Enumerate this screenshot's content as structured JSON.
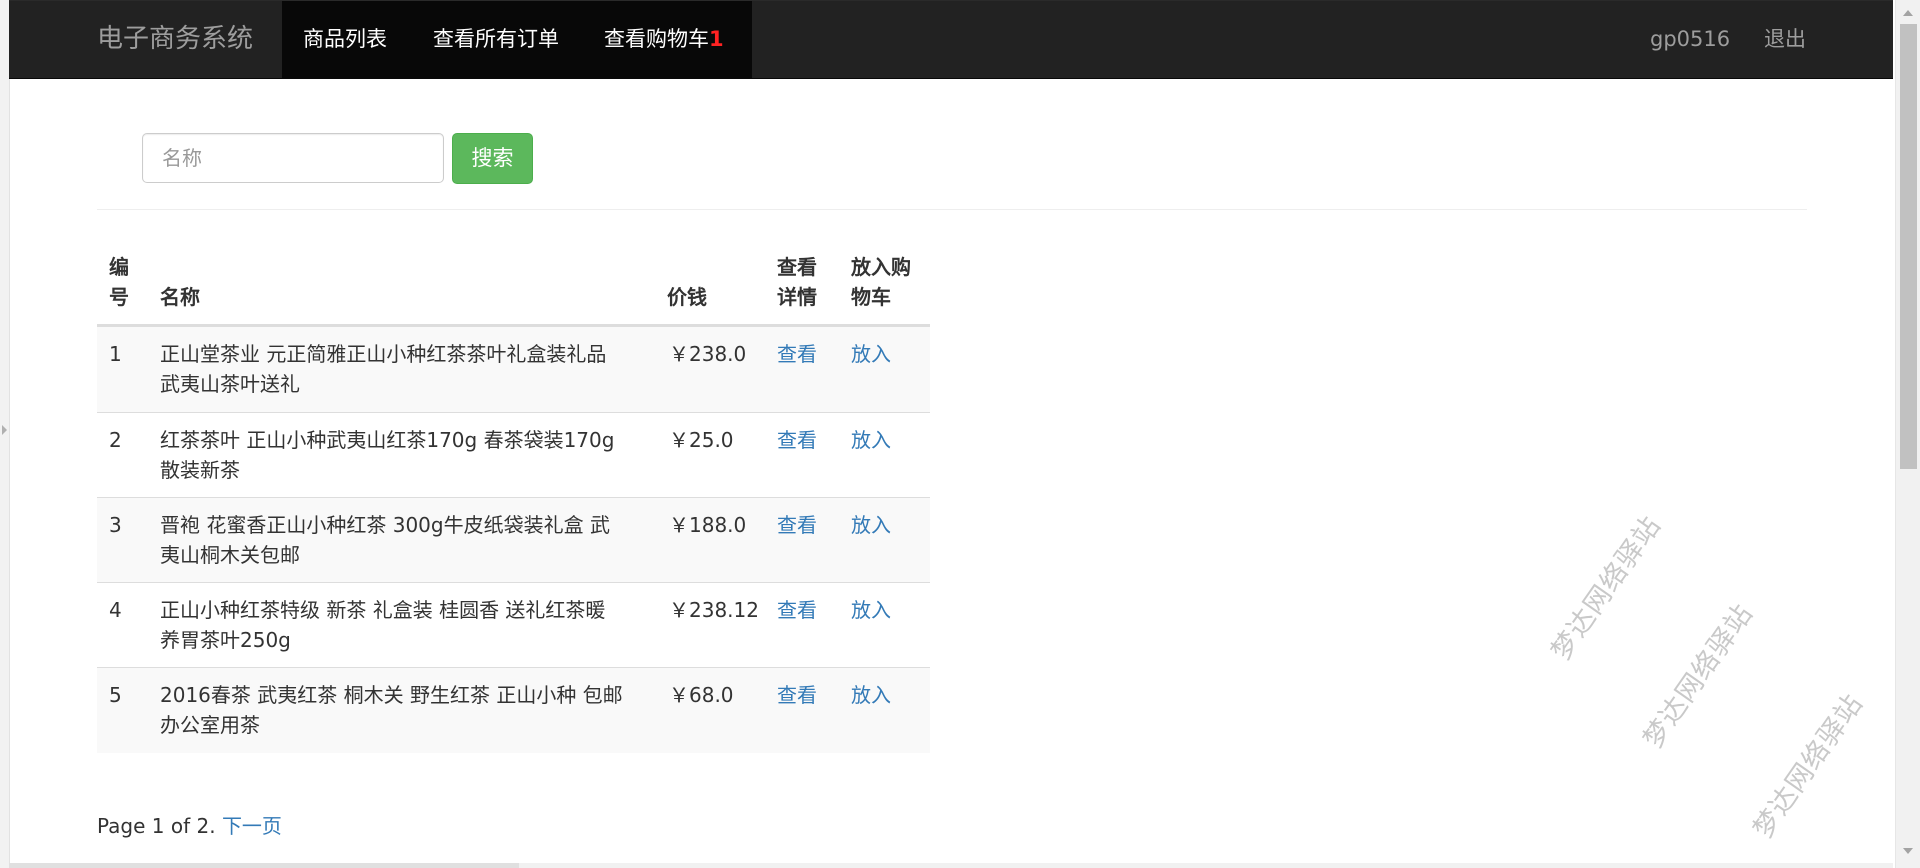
{
  "app": {
    "brand": "电子商务系统"
  },
  "nav": {
    "items": [
      {
        "label": "商品列表"
      },
      {
        "label": "查看所有订单"
      },
      {
        "label": "查看购物车"
      }
    ],
    "cart_count": "1",
    "user": "gp0516",
    "logout": "退出"
  },
  "search": {
    "placeholder": "名称",
    "value": "",
    "button_label": "搜索"
  },
  "table": {
    "headers": {
      "id_line1": "编",
      "id_line2": "号",
      "name": "名称",
      "price": "价钱",
      "view_line1": "查看",
      "view_line2": "详情",
      "cart_line1": "放入购",
      "cart_line2": "物车"
    },
    "rows": [
      {
        "id": "1",
        "name_line1": "正山堂茶业 元正简雅正山小种红茶茶叶礼盒装礼品",
        "name_line2": "武夷山茶叶送礼",
        "price": "￥238.0",
        "view": "查看",
        "add": "放入"
      },
      {
        "id": "2",
        "name_line1": "红茶茶叶 正山小种武夷山红茶170g 春茶袋装170g",
        "name_line2": "散装新茶",
        "price": "￥25.0",
        "view": "查看",
        "add": "放入"
      },
      {
        "id": "3",
        "name_line1": "晋袍 花蜜香正山小种红茶 300g牛皮纸袋装礼盒 武",
        "name_line2": "夷山桐木关包邮",
        "price": "￥188.0",
        "view": "查看",
        "add": "放入"
      },
      {
        "id": "4",
        "name_line1": "正山小种红茶特级 新茶 礼盒装 桂圆香 送礼红茶暖",
        "name_line2": "养胃茶叶250g",
        "price": "￥238.12",
        "view": "查看",
        "add": "放入"
      },
      {
        "id": "5",
        "name_line1": "2016春茶 武夷红茶 桐木关 野生红茶 正山小种 包邮",
        "name_line2": "办公室用茶",
        "price": "￥68.0",
        "view": "查看",
        "add": "放入"
      }
    ]
  },
  "pagination": {
    "info": "Page 1 of 2.",
    "next": "下一页"
  },
  "watermark": {
    "text": "梦达网络驿站"
  },
  "colors": {
    "navbar_bg": "#222222",
    "accent_link": "#337ab7",
    "success_button": "#5cb85c",
    "cart_badge": "#ff2222"
  }
}
